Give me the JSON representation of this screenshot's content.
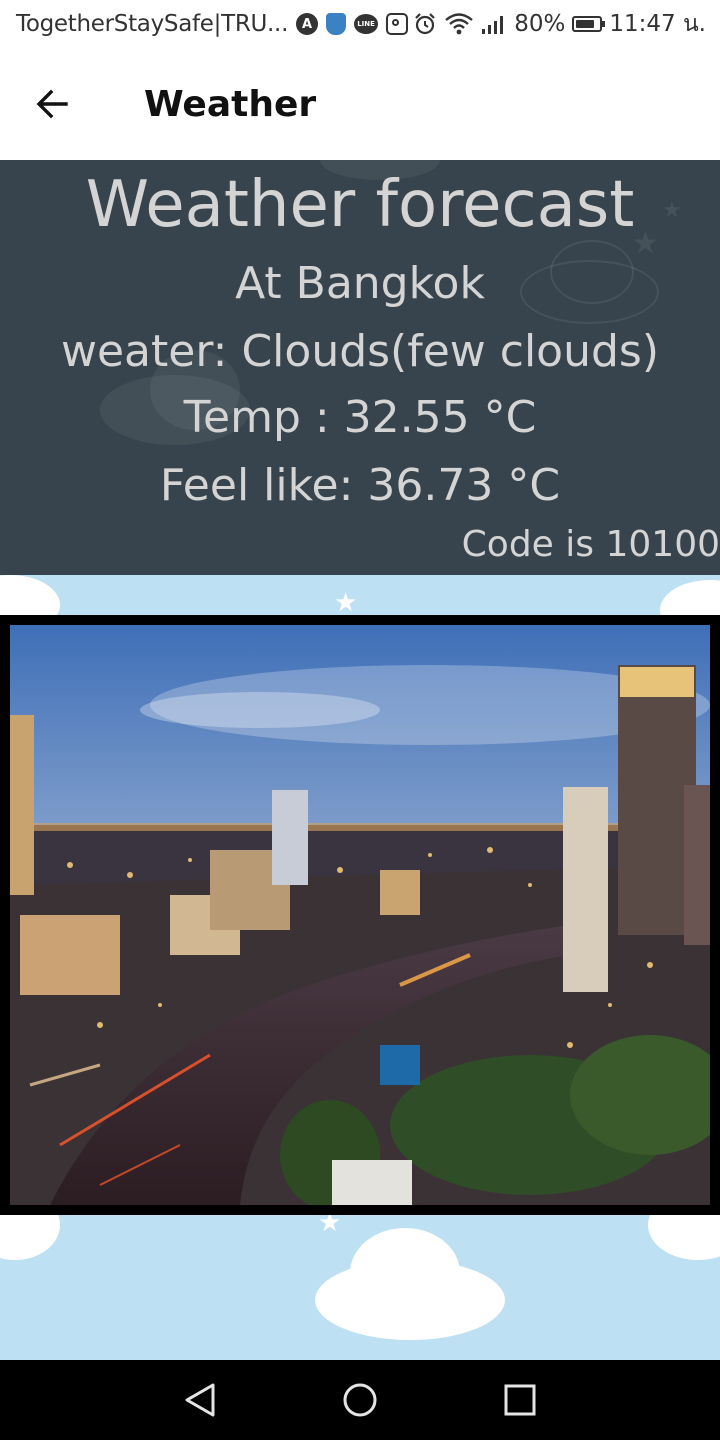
{
  "status_bar": {
    "carrier_text": "TogetherStaySafe|TRU...",
    "icons": [
      "a-circle-icon",
      "shield-icon",
      "line-icon",
      "instagram-icon",
      "alarm-icon",
      "wifi-icon",
      "signal-icon",
      "battery-icon"
    ],
    "line_label": "LINE",
    "a_label": "A",
    "battery_percent": "80%",
    "battery_level": 0.8,
    "time": "11:47 น."
  },
  "app_bar": {
    "back_icon": "arrow-left-icon",
    "title": "Weather"
  },
  "forecast": {
    "title": "Weather forecast",
    "location": "At Bangkok",
    "weather": "weater: Clouds(few clouds)",
    "temp": "Temp : 32.55 °C",
    "feels_like": "Feel like: 36.73 °C",
    "code": "Code is 10100"
  },
  "colors": {
    "panel_bg": "#37444d",
    "sky_bg": "#bde0f2",
    "text_light": "#d4d4d4"
  },
  "photo": {
    "subject": "Bangkok skyline at dusk with river"
  },
  "nav_bar": {
    "back": "triangle-back-icon",
    "home": "circle-home-icon",
    "recents": "square-recents-icon"
  }
}
